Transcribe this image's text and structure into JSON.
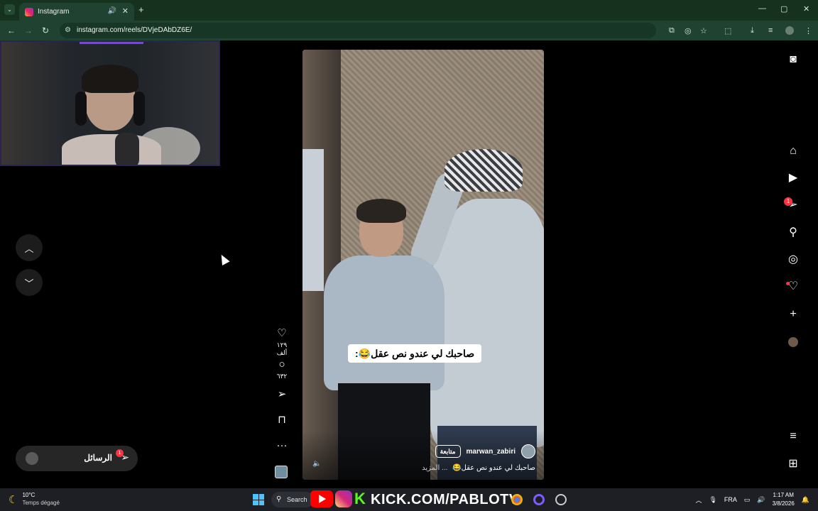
{
  "browser": {
    "tab_title": "Instagram",
    "tab_audio_icon": "🔊",
    "tab_close": "✕",
    "new_tab": "+",
    "tab_menu": "⌄",
    "url": "instagram.com/reels/DVjeDAbDZ6E/",
    "window_minimize": "—",
    "window_maximize": "▢",
    "window_close": "✕"
  },
  "reel": {
    "caption_overlay": "صاحبك لي عندو نص عقل😂:",
    "author": "marwan_zabiri",
    "follow_label": "متابعة",
    "description": "صاحبك لي عندو نص عقل😂",
    "more_label": "... المزيد",
    "likes": "١٢٩ ألف",
    "comments": "٦٣٢"
  },
  "messages": {
    "label": "الرسائل",
    "badge": "1"
  },
  "sidebar": {
    "notification_badge": "1"
  },
  "taskbar": {
    "temperature": "10°C",
    "weather_desc": "Temps dégagé",
    "search_label": "Search",
    "stream_text": "KICK.COM/PABLOTV",
    "stream_k": "K",
    "language": "FRA",
    "time": "1:17 AM",
    "date": "3/8/2026"
  },
  "colors": {
    "chrome_dark": "#16321f",
    "chrome_toolbar": "#1f4330",
    "notification_red": "#ff3040",
    "kick_green": "#53fc18"
  }
}
